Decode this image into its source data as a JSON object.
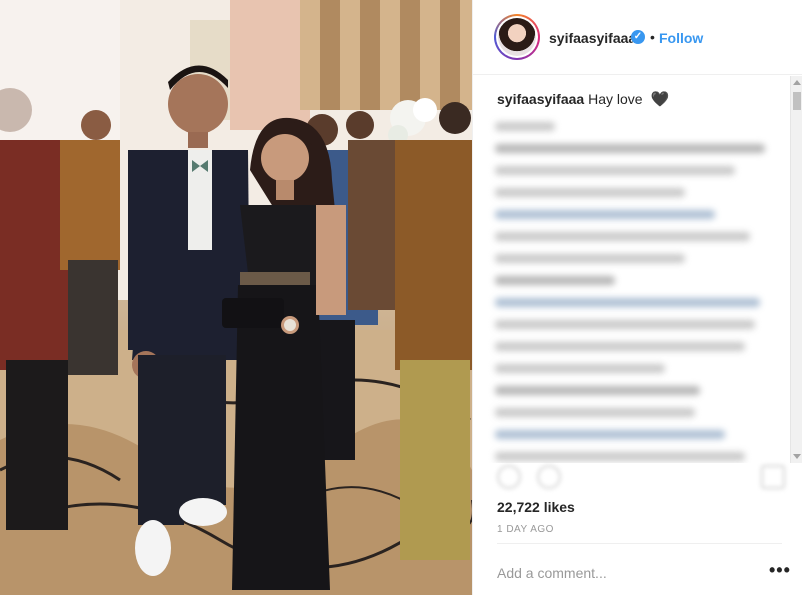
{
  "header": {
    "username": "syifaasyifaaa",
    "separator": "•",
    "follow_label": "Follow",
    "verified_icon": "verified-badge-icon"
  },
  "caption": {
    "username": "syifaasyifaaa",
    "text": "Hay love",
    "emoji": "🖤"
  },
  "post": {
    "likes": "22,722 likes",
    "time": "1 DAY AGO",
    "add_comment_placeholder": "Add a comment...",
    "more_icon": "•••"
  },
  "colors": {
    "accent": "#3897f0",
    "text": "#262626",
    "muted": "#999999"
  }
}
